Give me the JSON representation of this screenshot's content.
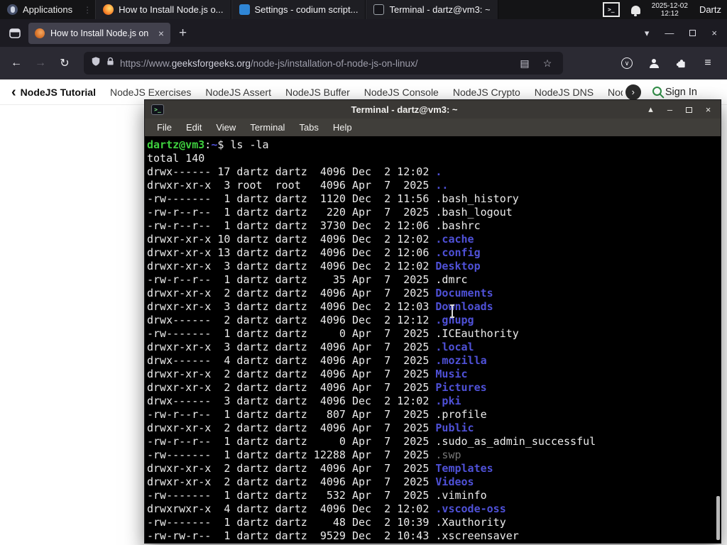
{
  "colors": {
    "gfg_green": "#2f8d46",
    "terminal_dir_blue": "#4f51d8",
    "terminal_prompt_green": "#3ecf3e",
    "firefox_orange": "#e3590f"
  },
  "icons": {
    "back": "←",
    "forward": "→",
    "reload": "↻",
    "reader": "▤",
    "star": "☆",
    "hamburger": "≡",
    "pocket_chevron": "∨",
    "list_tabs": "▾",
    "window_minimize": "—",
    "window_close": "×",
    "tab_close": "×",
    "new_tab": "+",
    "shade": "▴",
    "terminal_minimize": "–",
    "terminal_close": "×",
    "back_chevron": "‹",
    "next_chevron": "›",
    "panel_divider": "⋮",
    "terminal_glyph": ">_"
  },
  "panel": {
    "applications_label": "Applications",
    "windows": [
      {
        "label": "How to Install Node.js o...",
        "icon": "firefox"
      },
      {
        "label": "Settings - codium script...",
        "icon": "codium"
      },
      {
        "label": "Terminal - dartz@vm3: ~",
        "icon": "terminal"
      }
    ],
    "clock_date": "2025-12-02",
    "clock_time": "12:12",
    "user_label": "Dartz"
  },
  "browser": {
    "tab": {
      "title": "How to Install Node.js on"
    },
    "urlbar": {
      "protocol": "https://www.",
      "domain": "geeksforgeeks.org",
      "path": "/node-js/installation-of-node-js-on-linux/"
    },
    "site_nav": {
      "items": [
        {
          "label": "NodeJS Tutorial",
          "style": "primary"
        },
        {
          "label": "NodeJS Exercises",
          "style": "normal"
        },
        {
          "label": "NodeJS Assert",
          "style": "normal"
        },
        {
          "label": "NodeJS Buffer",
          "style": "normal"
        },
        {
          "label": "NodeJS Console",
          "style": "normal"
        },
        {
          "label": "NodeJS Crypto",
          "style": "normal"
        },
        {
          "label": "NodeJS DNS",
          "style": "normal"
        },
        {
          "label": "Node",
          "style": "normal"
        }
      ],
      "sign_in_label": "Sign In"
    }
  },
  "terminal": {
    "title": "Terminal - dartz@vm3: ~",
    "menu": [
      {
        "label": "File"
      },
      {
        "label": "Edit"
      },
      {
        "label": "View"
      },
      {
        "label": "Terminal"
      },
      {
        "label": "Tabs"
      },
      {
        "label": "Help"
      }
    ],
    "prompt": {
      "user": "dartz@vm3",
      "colon": ":",
      "path": "~",
      "dollar": "$ ",
      "command": "ls -la"
    },
    "total_line": "total 140",
    "entries": [
      {
        "pre": "drwx------ 17 dartz dartz  4096 Dec  2 12:02 ",
        "name": ".",
        "type": "dir"
      },
      {
        "pre": "drwxr-xr-x  3 root  root   4096 Apr  7  2025 ",
        "name": "..",
        "type": "dir"
      },
      {
        "pre": "-rw-------  1 dartz dartz  1120 Dec  2 11:56 ",
        "name": ".bash_history",
        "type": "file"
      },
      {
        "pre": "-rw-r--r--  1 dartz dartz   220 Apr  7  2025 ",
        "name": ".bash_logout",
        "type": "file"
      },
      {
        "pre": "-rw-r--r--  1 dartz dartz  3730 Dec  2 12:06 ",
        "name": ".bashrc",
        "type": "file"
      },
      {
        "pre": "drwxr-xr-x 10 dartz dartz  4096 Dec  2 12:02 ",
        "name": ".cache",
        "type": "dir"
      },
      {
        "pre": "drwxr-xr-x 13 dartz dartz  4096 Dec  2 12:06 ",
        "name": ".config",
        "type": "dir"
      },
      {
        "pre": "drwxr-xr-x  3 dartz dartz  4096 Dec  2 12:02 ",
        "name": "Desktop",
        "type": "dir"
      },
      {
        "pre": "-rw-r--r--  1 dartz dartz    35 Apr  7  2025 ",
        "name": ".dmrc",
        "type": "file"
      },
      {
        "pre": "drwxr-xr-x  2 dartz dartz  4096 Apr  7  2025 ",
        "name": "Documents",
        "type": "dir"
      },
      {
        "pre": "drwxr-xr-x  3 dartz dartz  4096 Dec  2 12:03 ",
        "name": "Downloads",
        "type": "dir"
      },
      {
        "pre": "drwx------  2 dartz dartz  4096 Dec  2 12:12 ",
        "name": ".gnupg",
        "type": "dir"
      },
      {
        "pre": "-rw-------  1 dartz dartz     0 Apr  7  2025 ",
        "name": ".ICEauthority",
        "type": "file"
      },
      {
        "pre": "drwxr-xr-x  3 dartz dartz  4096 Apr  7  2025 ",
        "name": ".local",
        "type": "dir"
      },
      {
        "pre": "drwx------  4 dartz dartz  4096 Apr  7  2025 ",
        "name": ".mozilla",
        "type": "dir"
      },
      {
        "pre": "drwxr-xr-x  2 dartz dartz  4096 Apr  7  2025 ",
        "name": "Music",
        "type": "dir"
      },
      {
        "pre": "drwxr-xr-x  2 dartz dartz  4096 Apr  7  2025 ",
        "name": "Pictures",
        "type": "dir"
      },
      {
        "pre": "drwx------  3 dartz dartz  4096 Dec  2 12:02 ",
        "name": ".pki",
        "type": "dir"
      },
      {
        "pre": "-rw-r--r--  1 dartz dartz   807 Apr  7  2025 ",
        "name": ".profile",
        "type": "file"
      },
      {
        "pre": "drwxr-xr-x  2 dartz dartz  4096 Apr  7  2025 ",
        "name": "Public",
        "type": "dir"
      },
      {
        "pre": "-rw-r--r--  1 dartz dartz     0 Apr  7  2025 ",
        "name": ".sudo_as_admin_successful",
        "type": "file"
      },
      {
        "pre": "-rw-------  1 dartz dartz 12288 Apr  7  2025 ",
        "name": ".swp",
        "type": "dim"
      },
      {
        "pre": "drwxr-xr-x  2 dartz dartz  4096 Apr  7  2025 ",
        "name": "Templates",
        "type": "dir"
      },
      {
        "pre": "drwxr-xr-x  2 dartz dartz  4096 Apr  7  2025 ",
        "name": "Videos",
        "type": "dir"
      },
      {
        "pre": "-rw-------  1 dartz dartz   532 Apr  7  2025 ",
        "name": ".viminfo",
        "type": "file"
      },
      {
        "pre": "drwxrwxr-x  4 dartz dartz  4096 Dec  2 12:02 ",
        "name": ".vscode-oss",
        "type": "dir"
      },
      {
        "pre": "-rw-------  1 dartz dartz    48 Dec  2 10:39 ",
        "name": ".Xauthority",
        "type": "file"
      },
      {
        "pre": "-rw-rw-r--  1 dartz dartz  9529 Dec  2 10:43 ",
        "name": ".xscreensaver",
        "type": "file"
      }
    ]
  }
}
